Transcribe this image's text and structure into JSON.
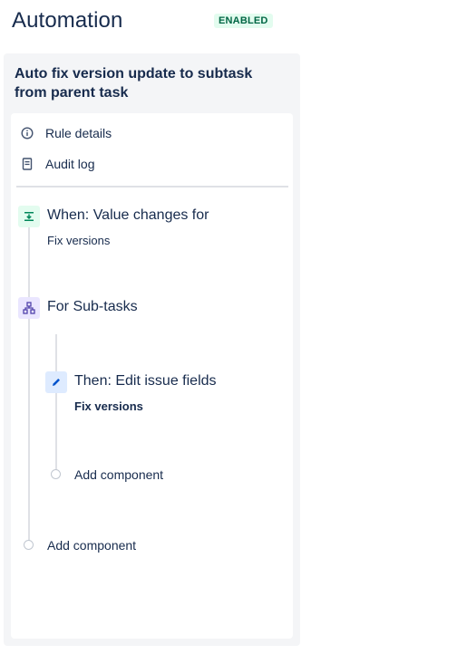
{
  "header": {
    "title": "Automation",
    "status": "ENABLED"
  },
  "rule": {
    "name": "Auto fix version update to subtask from parent task",
    "menu": [
      {
        "label": "Rule details",
        "icon": "info-icon"
      },
      {
        "label": "Audit log",
        "icon": "audit-log-icon"
      }
    ],
    "trigger": {
      "title": "When: Value changes for",
      "detail": "Fix versions",
      "icon": "trigger-icon"
    },
    "branch": {
      "title": "For Sub-tasks",
      "icon": "branch-icon",
      "action": {
        "title": "Then: Edit issue fields",
        "detail": "Fix versions",
        "icon": "pencil-icon"
      },
      "add_component": "Add component"
    },
    "add_component": "Add component"
  },
  "colors": {
    "trigger_bg": "#e3fcef",
    "branch_bg": "#eae6ff",
    "action_bg": "#deebff",
    "badge_text": "#006644"
  }
}
